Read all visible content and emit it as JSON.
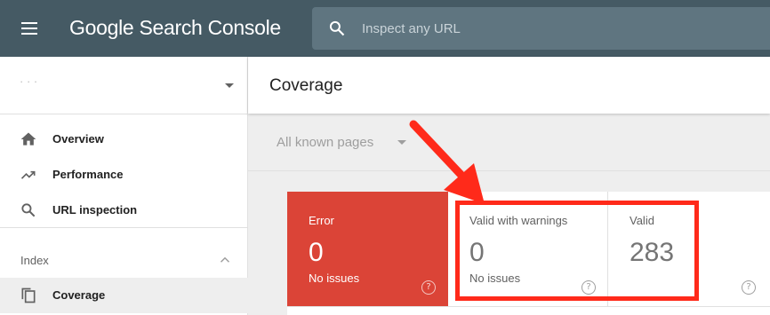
{
  "app": {
    "name": "Google Search Console"
  },
  "search": {
    "placeholder": "Inspect any URL"
  },
  "sidebar": {
    "property": "· · ·",
    "items": [
      {
        "label": "Overview",
        "icon": "home-icon"
      },
      {
        "label": "Performance",
        "icon": "trending-up-icon"
      },
      {
        "label": "URL inspection",
        "icon": "search-icon"
      }
    ],
    "section": {
      "label": "Index"
    },
    "section_items": [
      {
        "label": "Coverage",
        "icon": "copy-pages-icon"
      }
    ]
  },
  "page": {
    "title": "Coverage"
  },
  "filter": {
    "label": "All known pages"
  },
  "cards": [
    {
      "title": "Error",
      "value": "0",
      "sub": "No issues",
      "help": "?"
    },
    {
      "title": "Valid with warnings",
      "value": "0",
      "sub": "No issues",
      "help": "?"
    },
    {
      "title": "Valid",
      "value": "283",
      "sub": "",
      "help": "?"
    }
  ],
  "colors": {
    "topbar": "#455a64",
    "error": "#db4437",
    "annotation": "#ff2a1a"
  }
}
